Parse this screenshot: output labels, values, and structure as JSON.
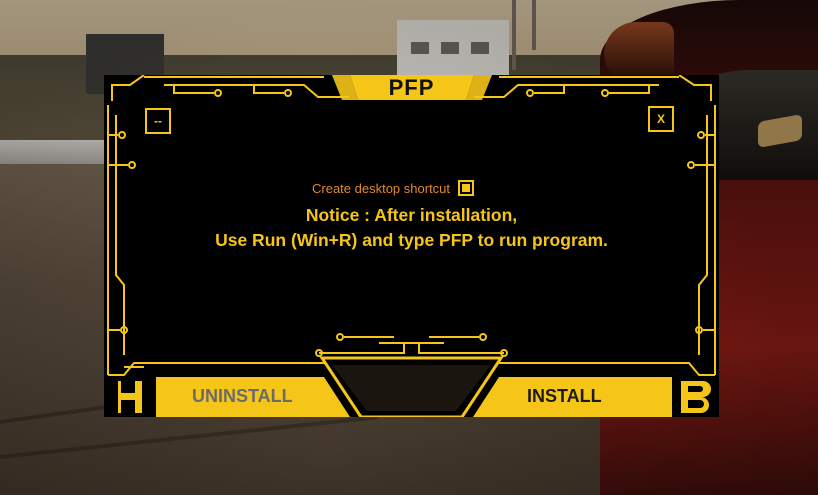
{
  "window": {
    "title": "PFP",
    "minimize_label": "--",
    "close_label": "X"
  },
  "options": {
    "shortcut_label": "Create desktop shortcut",
    "shortcut_checked": true
  },
  "notice": {
    "line1": "Notice : After installation,",
    "line2": "Use Run (Win+R) and type PFP to run program."
  },
  "buttons": {
    "uninstall_label": "UNINSTALL",
    "install_label": "INSTALL"
  },
  "branding": {
    "left_logo": "H",
    "right_logo": "B"
  },
  "colors": {
    "accent": "#f5c518",
    "checkbox_label": "#e08a2d",
    "window_bg": "#000000",
    "uninstall_text": "#6b6b6b"
  }
}
